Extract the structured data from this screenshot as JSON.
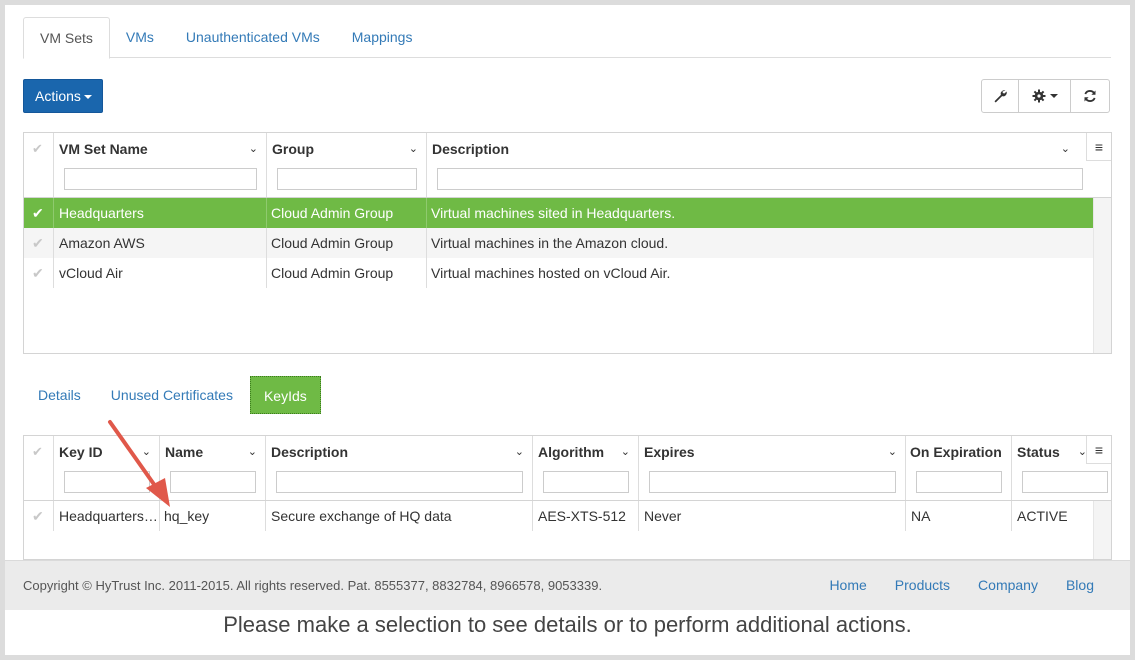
{
  "tabs": [
    {
      "label": "VM Sets",
      "active": true
    },
    {
      "label": "VMs",
      "active": false
    },
    {
      "label": "Unauthenticated VMs",
      "active": false
    },
    {
      "label": "Mappings",
      "active": false
    }
  ],
  "actions_button": {
    "label": "Actions"
  },
  "toolbar": {
    "icons": [
      "wrench-icon",
      "gear-icon",
      "refresh-icon"
    ]
  },
  "vmsets_grid": {
    "columns": [
      "VM Set Name",
      "Group",
      "Description"
    ],
    "rows": [
      {
        "name": "Headquarters",
        "group": "Cloud Admin Group",
        "description": "Virtual machines sited in Headquarters.",
        "selected": true
      },
      {
        "name": "Amazon AWS",
        "group": "Cloud Admin Group",
        "description": "Virtual machines in the Amazon cloud.",
        "selected": false
      },
      {
        "name": "vCloud Air",
        "group": "Cloud Admin Group",
        "description": "Virtual machines hosted on vCloud Air.",
        "selected": false
      }
    ]
  },
  "subtabs": [
    {
      "label": "Details",
      "active": false
    },
    {
      "label": "Unused Certificates",
      "active": false
    },
    {
      "label": "KeyIds",
      "active": true
    }
  ],
  "keyids_grid": {
    "columns": [
      "Key ID",
      "Name",
      "Description",
      "Algorithm",
      "Expires",
      "On Expiration",
      "Status"
    ],
    "rows": [
      {
        "key_id": "Headquarters…",
        "name": "hq_key",
        "description": "Secure exchange of HQ data",
        "algorithm": "AES-XTS-512",
        "expires": "Never",
        "on_expiration": "NA",
        "status": "ACTIVE"
      }
    ]
  },
  "footer": {
    "copyright": "Copyright © HyTrust Inc. 2011-2015. All rights reserved. Pat. 8555377, 8832784, 8966578, 9053339.",
    "links": [
      "Home",
      "Products",
      "Company",
      "Blog"
    ]
  },
  "status_message": "Please make a selection to see details or to perform additional actions.",
  "colors": {
    "accent": "#1a66ad",
    "selected_row": "#6fba45",
    "link": "#337ab7",
    "annotation_arrow": "#e0584a"
  }
}
